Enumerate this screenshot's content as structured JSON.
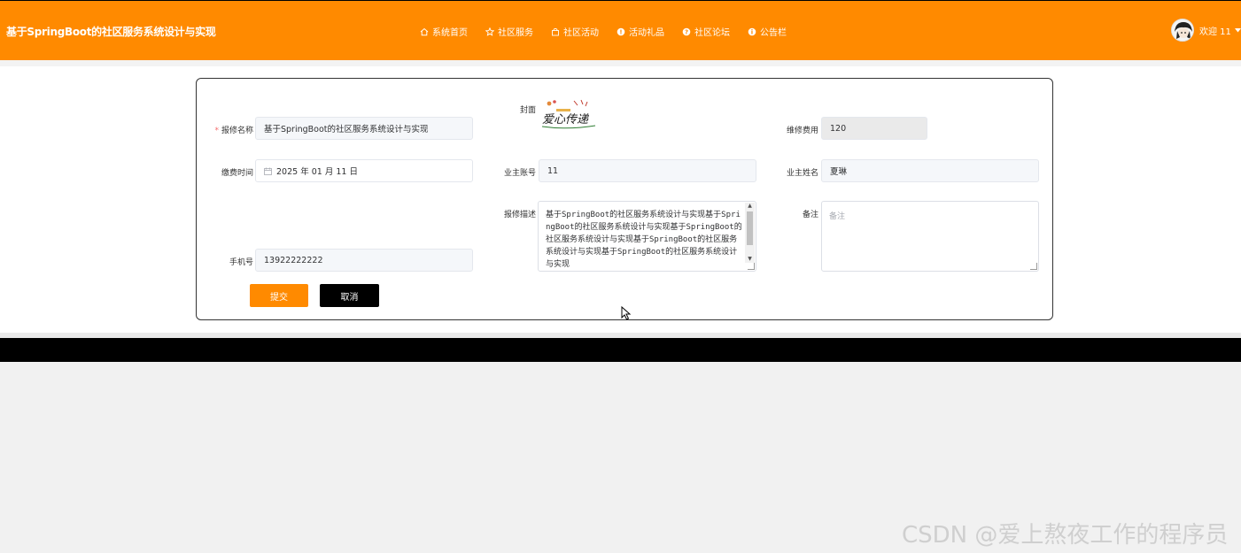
{
  "header": {
    "site_title": "基于SpringBoot的社区服务系统设计与实现",
    "nav": [
      {
        "label": "系统首页",
        "icon": "home-icon"
      },
      {
        "label": "社区服务",
        "icon": "star-icon"
      },
      {
        "label": "社区活动",
        "icon": "bag-icon"
      },
      {
        "label": "活动礼品",
        "icon": "info-circle-icon"
      },
      {
        "label": "社区论坛",
        "icon": "info-circle-icon"
      },
      {
        "label": "公告栏",
        "icon": "info-circle-icon"
      }
    ],
    "user": {
      "welcome": "欢迎 11"
    }
  },
  "form": {
    "repair_name": {
      "label": "报修名称",
      "value": "基于SpringBoot的社区服务系统设计与实现",
      "required": true
    },
    "cover": {
      "label": "封面",
      "image_text": "爱心传递"
    },
    "repair_cost": {
      "label": "维修费用",
      "value": "120"
    },
    "pay_time": {
      "label": "缴费时间",
      "value": "2025 年 01 月 11 日"
    },
    "owner_account": {
      "label": "业主账号",
      "value": "11"
    },
    "owner_name": {
      "label": "业主姓名",
      "value": "夏琳"
    },
    "repair_desc": {
      "label": "报修描述",
      "value": "基于SpringBoot的社区服务系统设计与实现基于SpringBoot的社区服务系统设计与实现基于SpringBoot的社区服务系统设计与实现基于SpringBoot的社区服务系统设计与实现基于SpringBoot的社区服务系统设计与实现"
    },
    "remark": {
      "label": "备注",
      "placeholder": "备注"
    },
    "phone": {
      "label": "手机号",
      "value": "13922222222"
    },
    "submit_label": "提交",
    "cancel_label": "取消"
  },
  "watermark": "CSDN @爱上熬夜工作的程序员",
  "colors": {
    "accent": "#ff8a00",
    "footer": "#000000"
  }
}
